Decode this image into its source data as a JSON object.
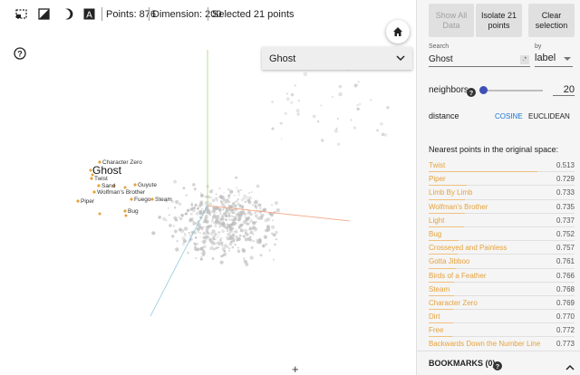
{
  "toolbar": {
    "points": "Points: 876",
    "dimension": "Dimension: 200",
    "selected": "Selected 21 points",
    "icons": [
      "select-box-icon",
      "night-mode-icon",
      "contrast-icon",
      "label-icon"
    ]
  },
  "projector": {
    "selected_label": "Ghost",
    "neighbor_labels": [
      {
        "text": "Character Zero"
      },
      {
        "text": "Twist"
      },
      {
        "text": "Sand"
      },
      {
        "text": "Guyute"
      },
      {
        "text": "Wolfman's Brother"
      },
      {
        "text": "Fuego"
      },
      {
        "text": "Steam"
      },
      {
        "text": "Piper"
      },
      {
        "text": "Bug"
      }
    ],
    "colors": {
      "x_axis": "#f4a582",
      "y_axis": "#a6d96a",
      "z_axis": "#92c5de",
      "highlight": "#e6a23c",
      "point": "#bdbdbd"
    }
  },
  "selection_dropdown": {
    "value": "Ghost"
  },
  "panel": {
    "show_all": "Show All\nData",
    "isolate": "Isolate 21\npoints",
    "clear": "Clear\nselection",
    "search_label": "Search",
    "search_value": "Ghost",
    "regex": ".*",
    "by_label": "by",
    "by_value": "label",
    "neighbors_label": "neighbors",
    "neighbors_value": "20",
    "neighbors_fraction": 0.0,
    "distance_label": "distance",
    "cosine": "COSINE",
    "euclidean": "EUCLIDEAN",
    "nearest_title": "Nearest points in the original space:",
    "nearest": [
      {
        "name": "Twist",
        "value": "0.513"
      },
      {
        "name": "Piper",
        "value": "0.729"
      },
      {
        "name": "Limb By Limb",
        "value": "0.733"
      },
      {
        "name": "Wolfman's Brother",
        "value": "0.735"
      },
      {
        "name": "Light",
        "value": "0.737"
      },
      {
        "name": "Bug",
        "value": "0.752"
      },
      {
        "name": "Crosseyed and Painless",
        "value": "0.757"
      },
      {
        "name": "Gotta Jibboo",
        "value": "0.761"
      },
      {
        "name": "Birds of a Feather",
        "value": "0.766"
      },
      {
        "name": "Steam",
        "value": "0.768"
      },
      {
        "name": "Character Zero",
        "value": "0.769"
      },
      {
        "name": "Dirt",
        "value": "0.770"
      },
      {
        "name": "Free",
        "value": "0.772"
      },
      {
        "name": "Backwards Down the Number Line",
        "value": "0.773"
      }
    ],
    "bookmarks": "BOOKMARKS (0)"
  }
}
